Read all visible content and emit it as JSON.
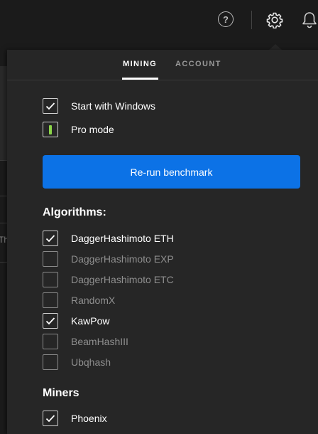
{
  "header": {
    "help_icon": "help-icon",
    "help_glyph": "?",
    "settings_icon": "gear-icon",
    "notifications_icon": "bell-icon"
  },
  "background": {
    "partial_text": "Th"
  },
  "tabs": [
    {
      "label": "MINING",
      "active": true
    },
    {
      "label": "ACCOUNT",
      "active": false
    }
  ],
  "general": {
    "start_with_windows": {
      "label": "Start with Windows",
      "checked": true
    },
    "pro_mode": {
      "label": "Pro mode",
      "enabled": true
    }
  },
  "benchmark_button": {
    "label": "Re-run benchmark"
  },
  "algorithms": {
    "title": "Algorithms:",
    "items": [
      {
        "label": "DaggerHashimoto ETH",
        "checked": true
      },
      {
        "label": "DaggerHashimoto EXP",
        "checked": false
      },
      {
        "label": "DaggerHashimoto ETC",
        "checked": false
      },
      {
        "label": "RandomX",
        "checked": false
      },
      {
        "label": "KawPow",
        "checked": true
      },
      {
        "label": "BeamHashIII",
        "checked": false
      },
      {
        "label": "Ubqhash",
        "checked": false
      }
    ]
  },
  "miners": {
    "title": "Miners",
    "items": [
      {
        "label": "Phoenix",
        "checked": true
      }
    ]
  },
  "colors": {
    "accent": "#0c72e6",
    "pro_mode_indicator": "#8bd449",
    "panel_bg": "#262626",
    "page_bg": "#1b1b1b"
  }
}
